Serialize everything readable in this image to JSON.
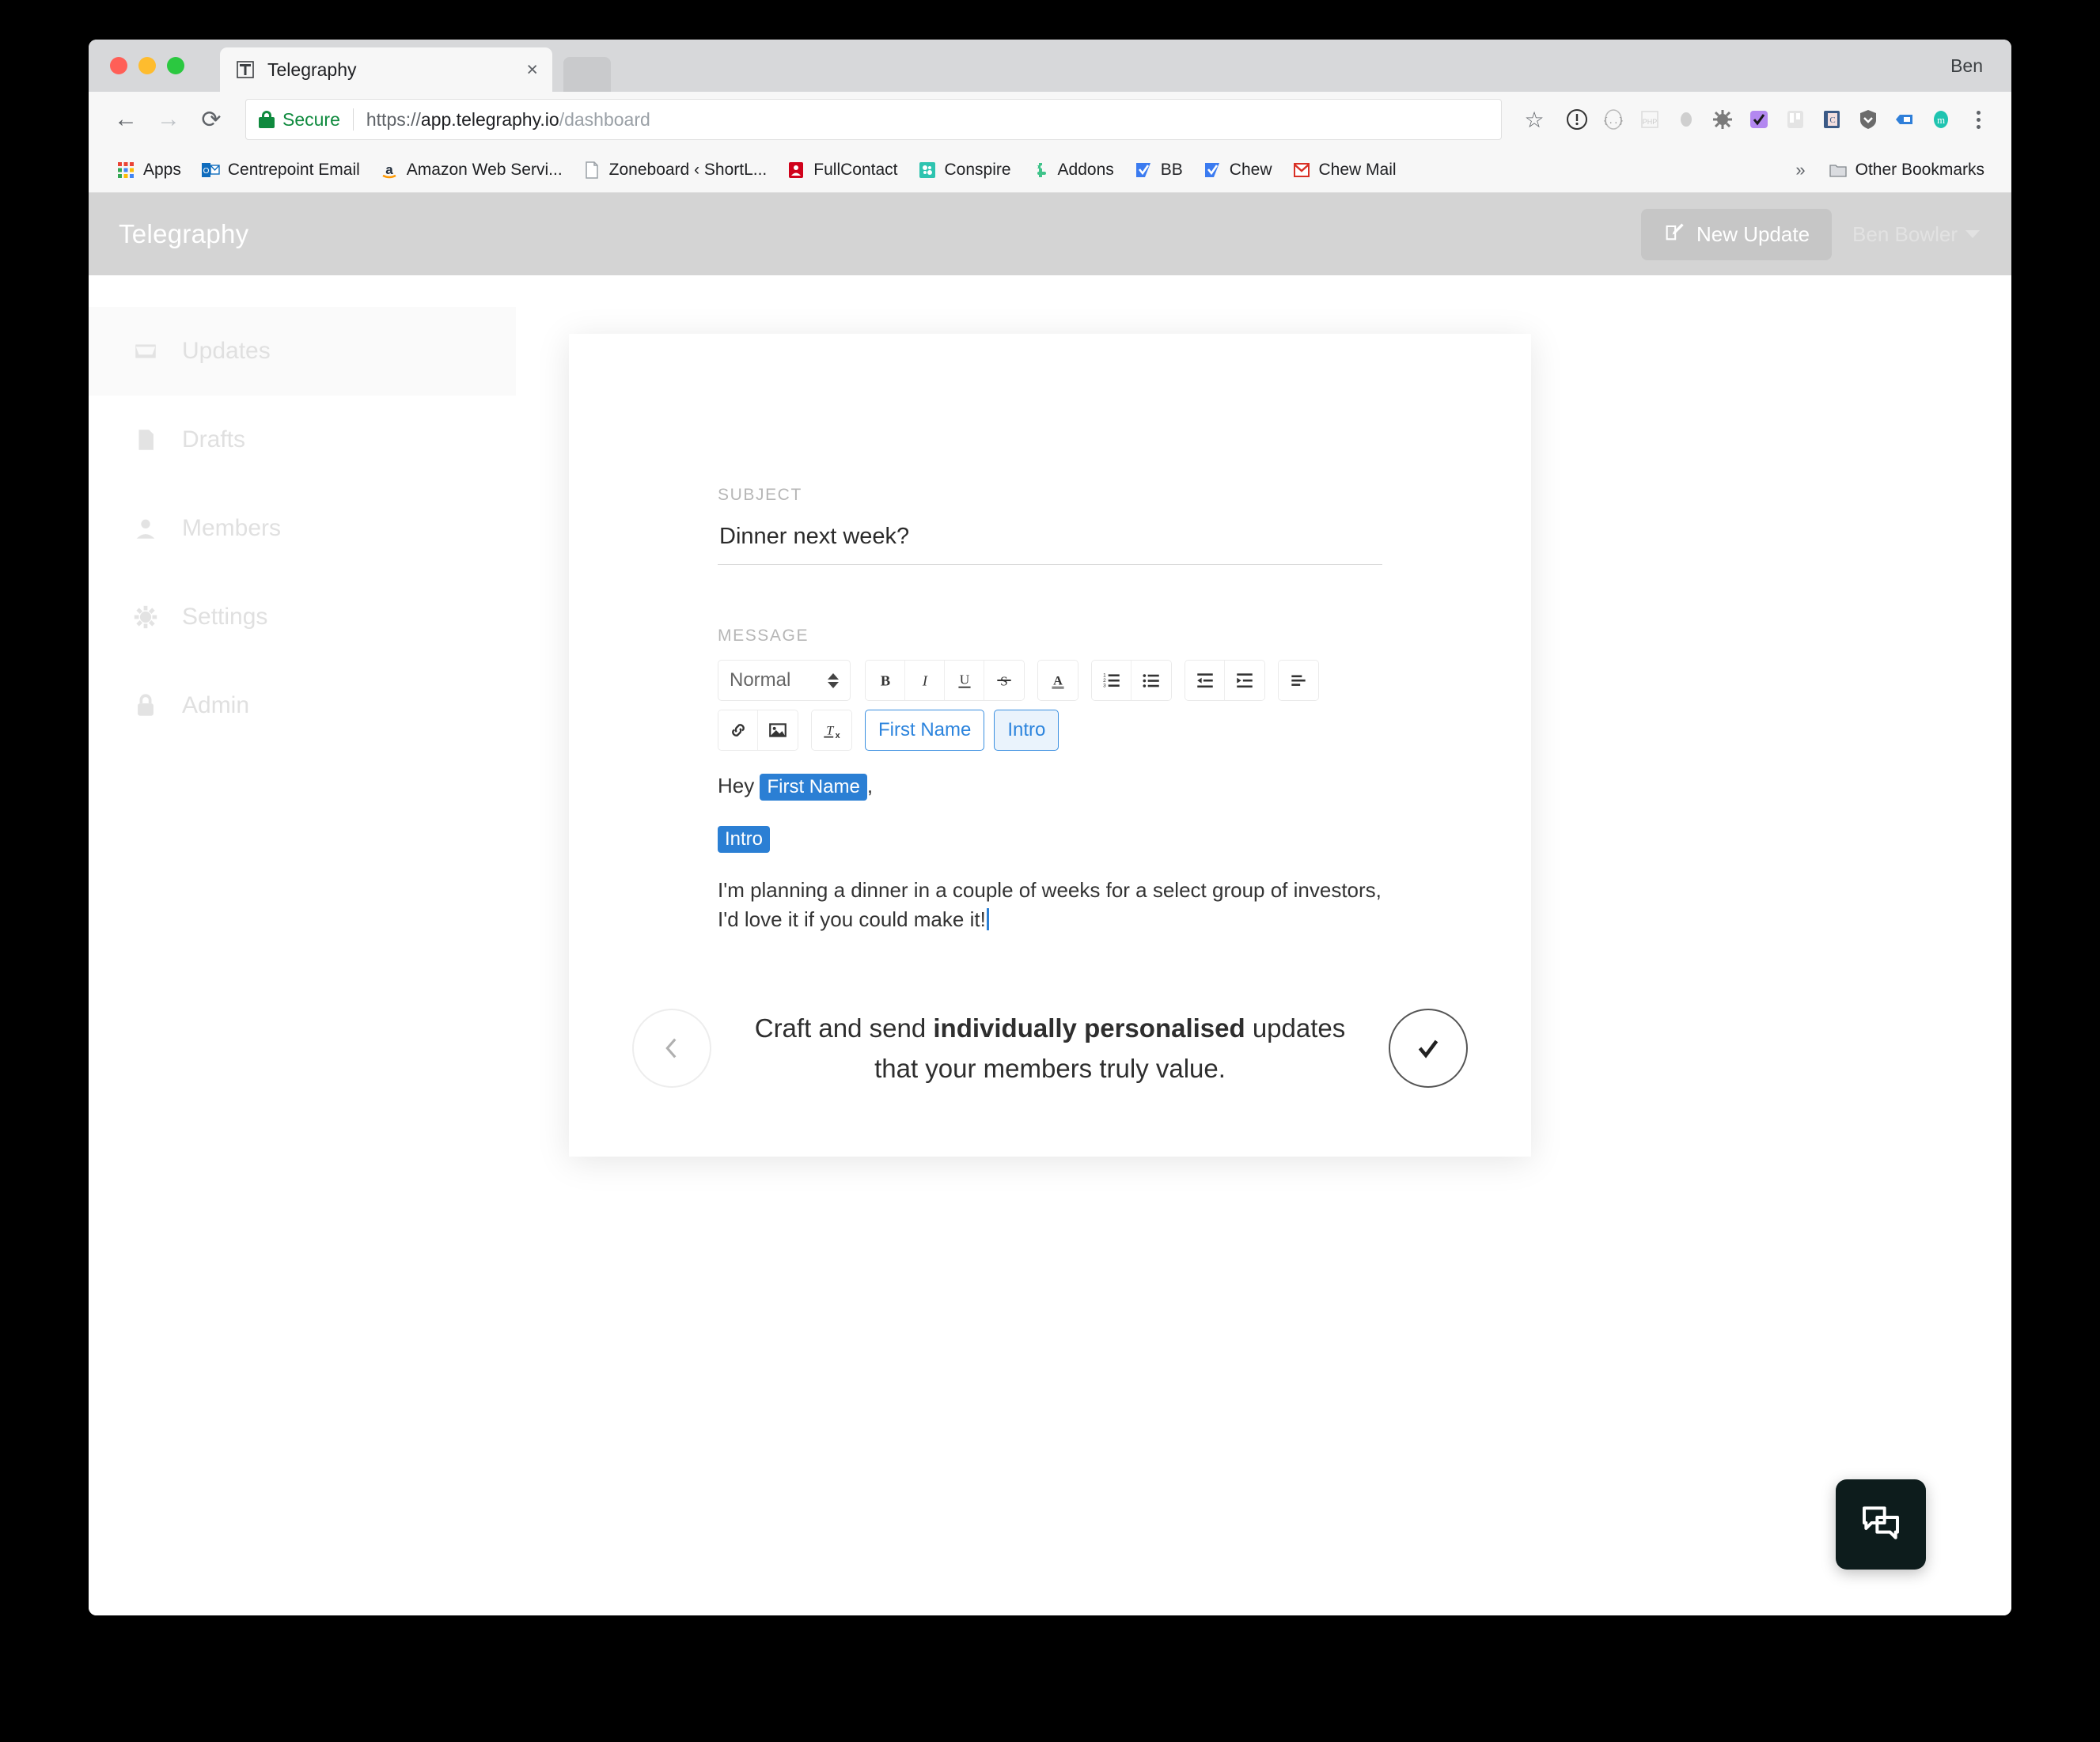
{
  "window": {
    "user_label": "Ben",
    "tab": {
      "title": "Telegraphy",
      "favicon": "telegraphy-logo-icon",
      "close": "×"
    }
  },
  "omnibox": {
    "back": "←",
    "forward": "→",
    "reload": "⟳",
    "secure_label": "Secure",
    "url_scheme": "https://",
    "url_host": "app.telegraphy.io",
    "url_path": "/dashboard",
    "star": "☆",
    "extensions": [
      "info-circle-icon",
      "braces-icon",
      "php-icon",
      "grey-dot-icon",
      "bug-icon",
      "purple-check-icon",
      "trello-icon",
      "contacts-icon",
      "shield-icon",
      "blue-tag-icon",
      "teal-m-icon"
    ]
  },
  "bookmarks": {
    "items": [
      {
        "label": "Apps",
        "icon": "apps-grid-icon"
      },
      {
        "label": "Centrepoint Email",
        "icon": "outlook-icon"
      },
      {
        "label": "Amazon Web Servi...",
        "icon": "amazon-icon"
      },
      {
        "label": "Zoneboard ‹ ShortL...",
        "icon": "page-icon"
      },
      {
        "label": "FullContact",
        "icon": "fullcontact-icon"
      },
      {
        "label": "Conspire",
        "icon": "conspire-icon"
      },
      {
        "label": "Addons",
        "icon": "addons-icon"
      },
      {
        "label": "BB",
        "icon": "bb-icon"
      },
      {
        "label": "Chew",
        "icon": "chew-icon"
      },
      {
        "label": "Chew Mail",
        "icon": "gmail-icon"
      }
    ],
    "overflow": "»",
    "other_label": "Other Bookmarks",
    "other_icon": "folder-icon"
  },
  "app": {
    "brand": "Telegraphy",
    "new_update_label": "New Update",
    "new_update_icon": "compose-icon",
    "user_name": "Ben Bowler",
    "sidebar": [
      {
        "label": "Updates",
        "icon": "inbox-icon",
        "active": true
      },
      {
        "label": "Drafts",
        "icon": "document-icon",
        "active": false
      },
      {
        "label": "Members",
        "icon": "person-icon",
        "active": false
      },
      {
        "label": "Settings",
        "icon": "gear-icon",
        "active": false
      },
      {
        "label": "Admin",
        "icon": "lock-icon",
        "active": false
      }
    ]
  },
  "modal": {
    "subject": {
      "label": "SUBJECT",
      "value": "Dinner next week?",
      "placeholder": "Subject"
    },
    "message": {
      "label": "MESSAGE",
      "format_select": "Normal",
      "toolbar_row1": [
        {
          "name": "bold-button",
          "glyph": "B"
        },
        {
          "name": "italic-button",
          "glyph": "I"
        },
        {
          "name": "underline-button",
          "glyph": "U"
        },
        {
          "name": "strike-button",
          "glyph": "S"
        },
        {
          "name": "text-color-button",
          "glyph": "A"
        },
        {
          "name": "ordered-list-button",
          "glyph": "ol"
        },
        {
          "name": "bullet-list-button",
          "glyph": "ul"
        },
        {
          "name": "outdent-button",
          "glyph": "outdent"
        },
        {
          "name": "indent-button",
          "glyph": "indent"
        },
        {
          "name": "align-button",
          "glyph": "align"
        }
      ],
      "toolbar_row2": [
        {
          "name": "link-button",
          "glyph": "link"
        },
        {
          "name": "image-button",
          "glyph": "image"
        },
        {
          "name": "clear-format-button",
          "glyph": "clear"
        }
      ],
      "tokens": [
        {
          "label": "First Name",
          "filled": false
        },
        {
          "label": "Intro",
          "filled": true
        }
      ],
      "body": {
        "greeting_prefix": "Hey ",
        "greeting_chip": "First Name",
        "greeting_suffix": ",",
        "intro_chip": "Intro",
        "paragraph": "I'm planning a dinner in a couple of weeks for a select group of investors, I'd love it if you could make it!"
      }
    },
    "footer": {
      "prev_icon": "chevron-left-icon",
      "next_icon": "check-icon",
      "tagline_part1": "Craft and send ",
      "tagline_bold": "individually personalised",
      "tagline_part2": " updates that your members truly value."
    }
  },
  "chat": {
    "icon": "chat-bubbles-icon"
  },
  "colors": {
    "accent_blue": "#2b7fd4",
    "token_blue": "#2c84dd",
    "secure_green": "#0f8a3e",
    "header_gray": "#d4d4d4",
    "chat_dark": "#0d1c1c"
  }
}
